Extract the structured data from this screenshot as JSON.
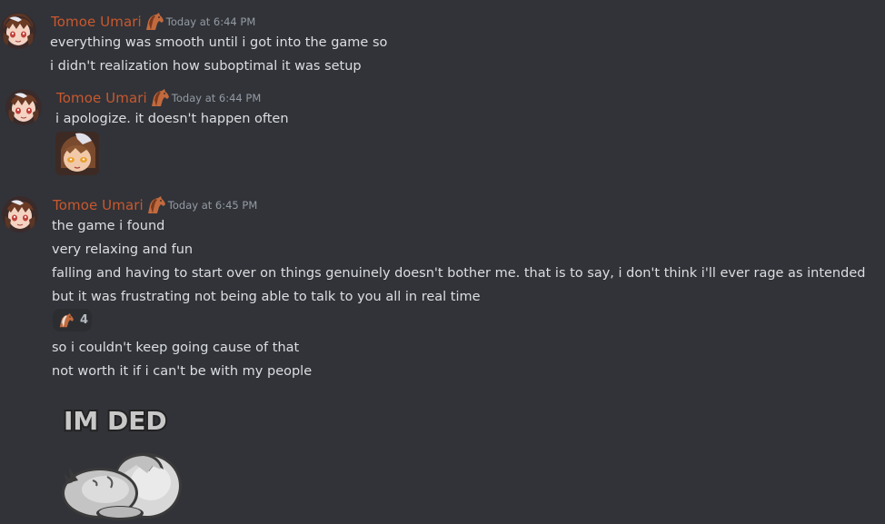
{
  "messages": [
    {
      "author": "Tomoe Umari",
      "timestamp": "Today at 6:44 PM",
      "lines": [
        "everything was smooth until i got into the game so",
        "i didn't realization how suboptimal it was setup"
      ]
    },
    {
      "author": "Tomoe Umari",
      "timestamp": "Today at 6:44 PM",
      "lines": [
        "i apologize. it doesn't happen often"
      ]
    },
    {
      "author": "Tomoe Umari",
      "timestamp": "Today at 6:45 PM",
      "lines": [
        "the game i found",
        "very relaxing and fun",
        "falling and having to start over on things genuinely doesn't bother me. that is to say, i don't think i'll ever rage as intended",
        "but it was frustrating not being able to talk to you all in real time"
      ],
      "reaction": {
        "emoji": "horse-emoji-icon",
        "count": "4"
      },
      "lines_after": [
        "so i couldn't keep going cause of that",
        "not worth it if i can't be with my people"
      ],
      "sticker_text": "IM DED"
    }
  ],
  "colors": {
    "background": "#313338",
    "username": "#c9582e",
    "text": "#dbdee1",
    "timestamp": "#949ba4"
  }
}
